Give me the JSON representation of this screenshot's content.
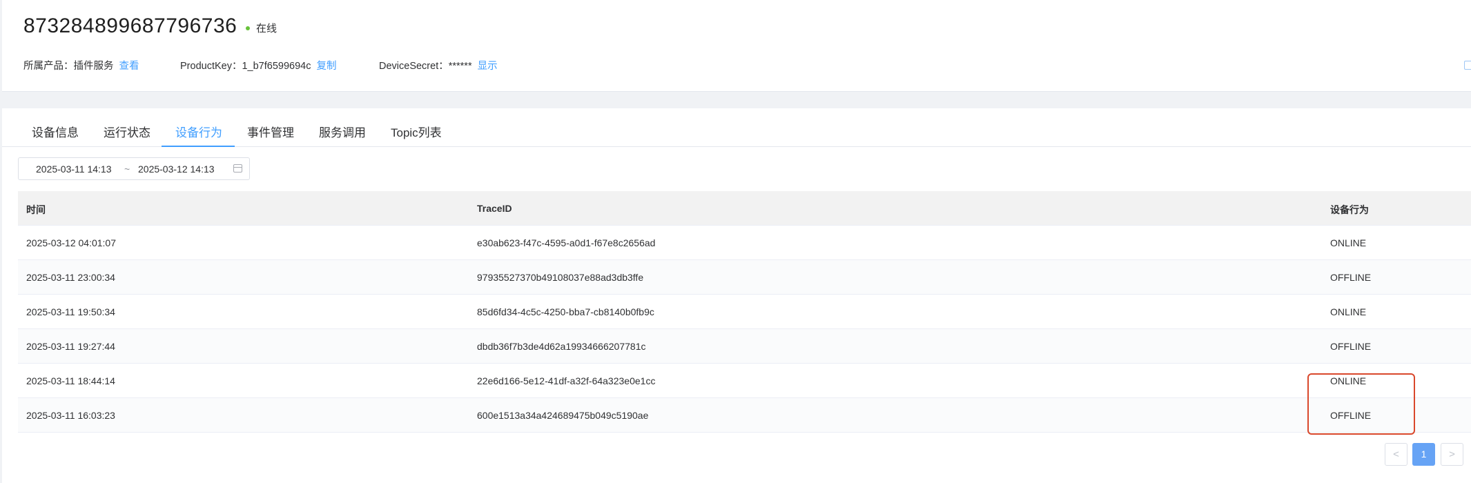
{
  "header": {
    "device_id": "873284899687796736",
    "status_text": "在线",
    "status_color": "#67c23a",
    "product_label": "所属产品：",
    "product_value": "插件服务",
    "product_link": "查看",
    "key_label": "ProductKey：",
    "key_value": "1_b7f6599694c",
    "key_link": "复制",
    "secret_label": "DeviceSecret：",
    "secret_value": "******",
    "secret_link": "显示"
  },
  "tabs": [
    {
      "label": "设备信息"
    },
    {
      "label": "运行状态"
    },
    {
      "label": "设备行为",
      "active": true
    },
    {
      "label": "事件管理"
    },
    {
      "label": "服务调用"
    },
    {
      "label": "Topic列表"
    }
  ],
  "date_range": {
    "start": "2025-03-11 14:13",
    "separator": "~",
    "end": "2025-03-12 14:13",
    "icon": "calendar-icon"
  },
  "table": {
    "columns": [
      "时间",
      "TraceID",
      "设备行为"
    ],
    "rows": [
      {
        "time": "2025-03-12 04:01:07",
        "trace_id": "e30ab623-f47c-4595-a0d1-f67e8c2656ad",
        "action": "ONLINE"
      },
      {
        "time": "2025-03-11 23:00:34",
        "trace_id": "97935527370b49108037e88ad3db3ffe",
        "action": "OFFLINE"
      },
      {
        "time": "2025-03-11 19:50:34",
        "trace_id": "85d6fd34-4c5c-4250-bba7-cb8140b0fb9c",
        "action": "ONLINE"
      },
      {
        "time": "2025-03-11 19:27:44",
        "trace_id": "dbdb36f7b3de4d62a19934666207781c",
        "action": "OFFLINE"
      },
      {
        "time": "2025-03-11 18:44:14",
        "trace_id": "22e6d166-5e12-41df-a32f-64a323e0e1cc",
        "action": "ONLINE"
      },
      {
        "time": "2025-03-11 16:03:23",
        "trace_id": "600e1513a34a424689475b049c5190ae",
        "action": "OFFLINE"
      }
    ]
  },
  "pagination": {
    "prev": "<",
    "current_page": "1",
    "next": ">"
  },
  "colors": {
    "accent": "#409eff",
    "highlight_box": "#d9472b"
  }
}
